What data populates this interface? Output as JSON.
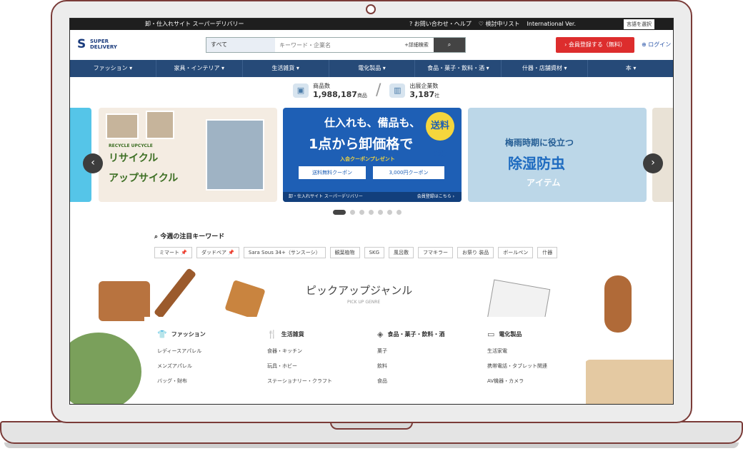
{
  "topbar": {
    "tagline": "卸・仕入れサイト スーパーデリバリー",
    "links": [
      "? お問い合わせ・ヘルプ",
      "♡ 検討中リスト",
      "International Ver."
    ],
    "language": "言語を選択"
  },
  "header": {
    "logo_line1": "SUPER",
    "logo_line2": "DELIVERY",
    "search_category": "すべて",
    "search_placeholder": "キーワード・企業名",
    "advanced": "+詳細検索",
    "register": "› 会員登録する（無料）",
    "login": "ログイン"
  },
  "nav": [
    "ファッション ▾",
    "家具・インテリア ▾",
    "生活雑貨 ▾",
    "電化製品 ▾",
    "食品・菓子・飲料・酒 ▾",
    "什器・店舗資材 ▾",
    "本 ▾"
  ],
  "stats": {
    "products_label": "商品数",
    "products_value": "1,988,187",
    "products_unit": "商品",
    "companies_label": "出展企業数",
    "companies_value": "3,187",
    "companies_unit": "社"
  },
  "banners": {
    "recycle_small": "RECYCLE UPCYCLE",
    "recycle_1": "リサイクル",
    "recycle_2": "アップサイクル",
    "main_1": "仕入れも、備品も、",
    "main_2": "1点から卸価格で",
    "free": "送料¥0",
    "coupon_tag": "入会クーポンプレゼント",
    "coupon_1": "送料無料クーポン",
    "coupon_2": "3,000円クーポン",
    "main_foot": "卸・仕入れサイト スーパーデリバリー",
    "main_cta": "会員登録はこちら ›",
    "rain_1": "梅雨時期に役立つ",
    "rain_2": "除湿防虫",
    "rain_3": "アイテム"
  },
  "keywords": {
    "title": "今週の注目キーワード",
    "items": [
      "ミマート 📌",
      "ダッドベア 📌",
      "Sara Sous 34+（サンスーシ）",
      "観葉植物",
      "SKG",
      "風呂敷",
      "フマキラー",
      "お祭り 装品",
      "ボールペン",
      "什器"
    ]
  },
  "pickup": {
    "title": "ピックアップジャンル",
    "subtitle": "PICK UP GENRE"
  },
  "genres": [
    {
      "title": "ファッション",
      "items": [
        "レディースアパレル",
        "メンズアパレル",
        "バッグ・財布"
      ]
    },
    {
      "title": "生活雑貨",
      "items": [
        "食器・キッチン",
        "玩具・ホビー",
        "ステーショナリー・クラフト"
      ]
    },
    {
      "title": "食品・菓子・飲料・酒",
      "items": [
        "菓子",
        "飲料",
        "食品"
      ]
    },
    {
      "title": "電化製品",
      "items": [
        "生活家電",
        "携帯電話・タブレット関連",
        "AV機器・カメラ"
      ]
    }
  ]
}
